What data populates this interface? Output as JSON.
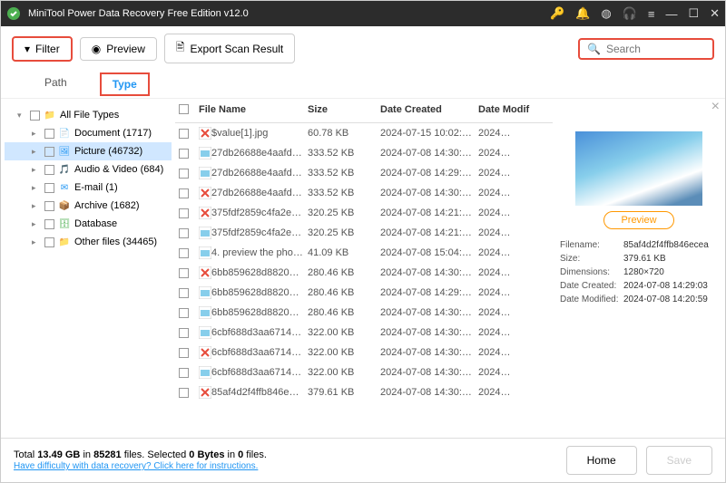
{
  "titlebar": {
    "title": "MiniTool Power Data Recovery Free Edition v12.0"
  },
  "toolbar": {
    "filter_label": "Filter",
    "preview_label": "Preview",
    "export_label": "Export Scan Result"
  },
  "search": {
    "placeholder": "Search"
  },
  "tabs": {
    "path": "Path",
    "type": "Type"
  },
  "sidebar": {
    "items": [
      {
        "label": "All File Types",
        "indent": 0,
        "chev": "▾",
        "icon": "folder",
        "sel": false
      },
      {
        "label": "Document (1717)",
        "indent": 1,
        "chev": "▸",
        "icon": "doc",
        "sel": false
      },
      {
        "label": "Picture (46732)",
        "indent": 1,
        "chev": "▸",
        "icon": "pic",
        "sel": true
      },
      {
        "label": "Audio & Video (684)",
        "indent": 1,
        "chev": "▸",
        "icon": "av",
        "sel": false
      },
      {
        "label": "E-mail (1)",
        "indent": 1,
        "chev": "▸",
        "icon": "mail",
        "sel": false
      },
      {
        "label": "Archive (1682)",
        "indent": 1,
        "chev": "▸",
        "icon": "arc",
        "sel": false
      },
      {
        "label": "Database",
        "indent": 1,
        "chev": "▸",
        "icon": "db",
        "sel": false
      },
      {
        "label": "Other files (34465)",
        "indent": 1,
        "chev": "▸",
        "icon": "folder",
        "sel": false
      }
    ]
  },
  "filehead": {
    "name": "File Name",
    "size": "Size",
    "created": "Date Created",
    "modified": "Date Modif"
  },
  "files": [
    {
      "name": "$value[1].jpg",
      "size": "60.78 KB",
      "created": "2024-07-15 10:02:…",
      "modified": "2024…",
      "x": true
    },
    {
      "name": "27db26688e4aafd…",
      "size": "333.52 KB",
      "created": "2024-07-08 14:30:…",
      "modified": "2024…",
      "x": false
    },
    {
      "name": "27db26688e4aafd…",
      "size": "333.52 KB",
      "created": "2024-07-08 14:29:…",
      "modified": "2024…",
      "x": false
    },
    {
      "name": "27db26688e4aafd…",
      "size": "333.52 KB",
      "created": "2024-07-08 14:30:…",
      "modified": "2024…",
      "x": true
    },
    {
      "name": "375fdf2859c4fa2e…",
      "size": "320.25 KB",
      "created": "2024-07-08 14:21:…",
      "modified": "2024…",
      "x": true
    },
    {
      "name": "375fdf2859c4fa2e…",
      "size": "320.25 KB",
      "created": "2024-07-08 14:21:…",
      "modified": "2024…",
      "x": false
    },
    {
      "name": "4. preview the pho…",
      "size": "41.09 KB",
      "created": "2024-07-08 15:04:…",
      "modified": "2024…",
      "x": false
    },
    {
      "name": "6bb859628d8820…",
      "size": "280.46 KB",
      "created": "2024-07-08 14:30:…",
      "modified": "2024…",
      "x": true
    },
    {
      "name": "6bb859628d8820…",
      "size": "280.46 KB",
      "created": "2024-07-08 14:29:…",
      "modified": "2024…",
      "x": false
    },
    {
      "name": "6bb859628d8820…",
      "size": "280.46 KB",
      "created": "2024-07-08 14:30:…",
      "modified": "2024…",
      "x": false
    },
    {
      "name": "6cbf688d3aa6714…",
      "size": "322.00 KB",
      "created": "2024-07-08 14:30:…",
      "modified": "2024…",
      "x": false
    },
    {
      "name": "6cbf688d3aa6714…",
      "size": "322.00 KB",
      "created": "2024-07-08 14:30:…",
      "modified": "2024…",
      "x": true
    },
    {
      "name": "6cbf688d3aa6714…",
      "size": "322.00 KB",
      "created": "2024-07-08 14:30:…",
      "modified": "2024…",
      "x": false
    },
    {
      "name": "85af4d2f4ffb846e…",
      "size": "379.61 KB",
      "created": "2024-07-08 14:30:…",
      "modified": "2024…",
      "x": true
    }
  ],
  "preview": {
    "btn": "Preview",
    "meta": {
      "filename_k": "Filename:",
      "filename_v": "85af4d2f4ffb846ecea",
      "size_k": "Size:",
      "size_v": "379.61 KB",
      "dim_k": "Dimensions:",
      "dim_v": "1280×720",
      "created_k": "Date Created:",
      "created_v": "2024-07-08 14:29:03",
      "modified_k": "Date Modified:",
      "modified_v": "2024-07-08 14:20:59"
    }
  },
  "footer": {
    "total_pre": "Total ",
    "total_gb": "13.49 GB",
    "total_mid": " in ",
    "total_files": "85281",
    "total_post": " files.",
    "sel_pre": "  Selected ",
    "sel_bytes": "0 Bytes",
    "sel_mid": " in ",
    "sel_files": "0",
    "sel_post": " files.",
    "help": "Have difficulty with data recovery? Click here for instructions.",
    "home": "Home",
    "save": "Save"
  }
}
